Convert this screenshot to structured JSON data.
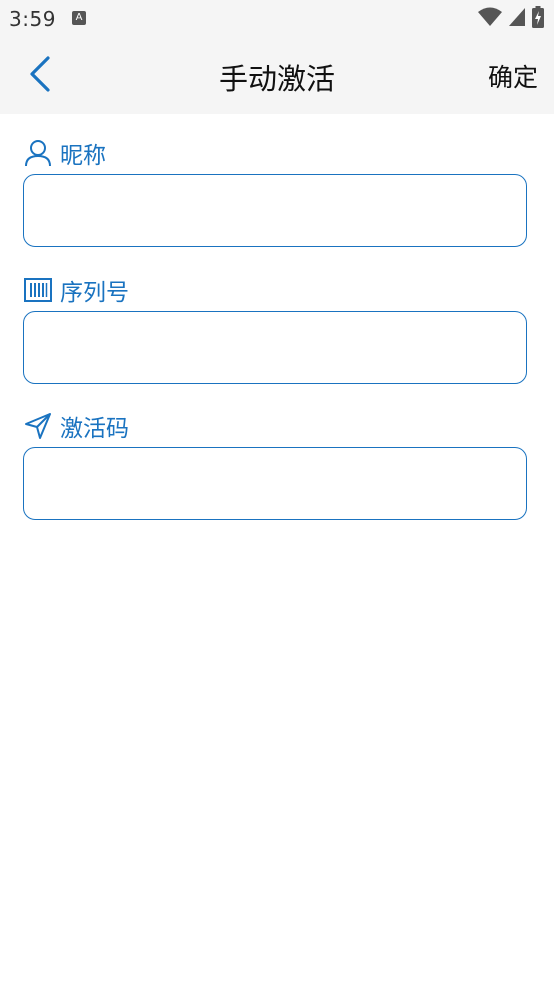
{
  "status_bar": {
    "time": "3:59",
    "notification_icon": "a-notification-icon",
    "wifi_icon": "wifi-icon",
    "signal_icon": "cell-signal-icon",
    "battery_icon": "battery-charging-icon"
  },
  "app_bar": {
    "title": "手动激活",
    "confirm_label": "确定",
    "back_icon": "chevron-left-icon"
  },
  "form": {
    "nickname": {
      "label": "昵称",
      "icon": "user-icon",
      "value": "",
      "placeholder": ""
    },
    "serial": {
      "label": "序列号",
      "icon": "barcode-icon",
      "value": "",
      "placeholder": ""
    },
    "activation_code": {
      "label": "激活码",
      "icon": "send-icon",
      "value": "",
      "placeholder": ""
    }
  },
  "colors": {
    "accent": "#1a73c0",
    "bar_background": "#f5f5f5",
    "text_primary": "#111111"
  }
}
